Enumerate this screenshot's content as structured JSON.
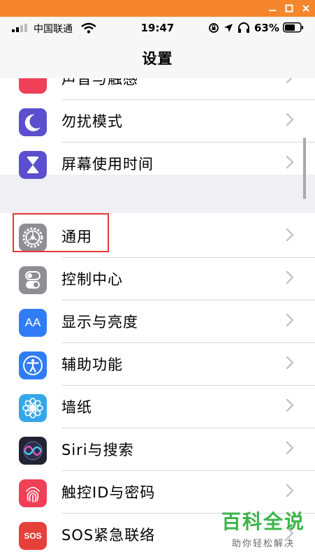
{
  "window": {
    "minimize_icon": "minimize-icon",
    "maximize_icon": "maximize-icon",
    "close_icon": "close-icon",
    "bar_color": "#f5862b"
  },
  "status": {
    "carrier": "中国联通",
    "time": "19:47",
    "battery": "63%"
  },
  "nav": {
    "title": "设置"
  },
  "rows": {
    "partial": {
      "label": "声音与触感",
      "color": "#ef4057"
    },
    "dnd": {
      "label": "勿扰模式",
      "icon": "moon-icon",
      "color": "#5b4fcf"
    },
    "screentime": {
      "label": "屏幕使用时间",
      "icon": "hourglass-icon",
      "color": "#5b4fcf"
    },
    "general": {
      "label": "通用",
      "icon": "gear-icon",
      "color": "#8e8e93"
    },
    "control": {
      "label": "控制中心",
      "icon": "switches-icon",
      "color": "#8e8e93"
    },
    "display": {
      "label": "显示与亮度",
      "icon": "aa-icon",
      "icon_text": "AA",
      "color": "#2f7cf6"
    },
    "access": {
      "label": "辅助功能",
      "icon": "accessibility-icon",
      "color": "#2f7cf6"
    },
    "wallpaper": {
      "label": "墙纸",
      "icon": "flower-icon",
      "color": "#35a7e8"
    },
    "siri": {
      "label": "Siri与搜索",
      "icon": "siri-icon",
      "color": "#222433"
    },
    "touchid": {
      "label": "触控ID与密码",
      "icon": "fingerprint-icon",
      "color": "#ef4057"
    },
    "sos": {
      "label": "SOS紧急联络",
      "icon": "sos-icon",
      "icon_text": "SOS",
      "color": "#e5403a"
    }
  },
  "watermark": {
    "line1": "百科全说",
    "line2": "助你轻松解决"
  }
}
